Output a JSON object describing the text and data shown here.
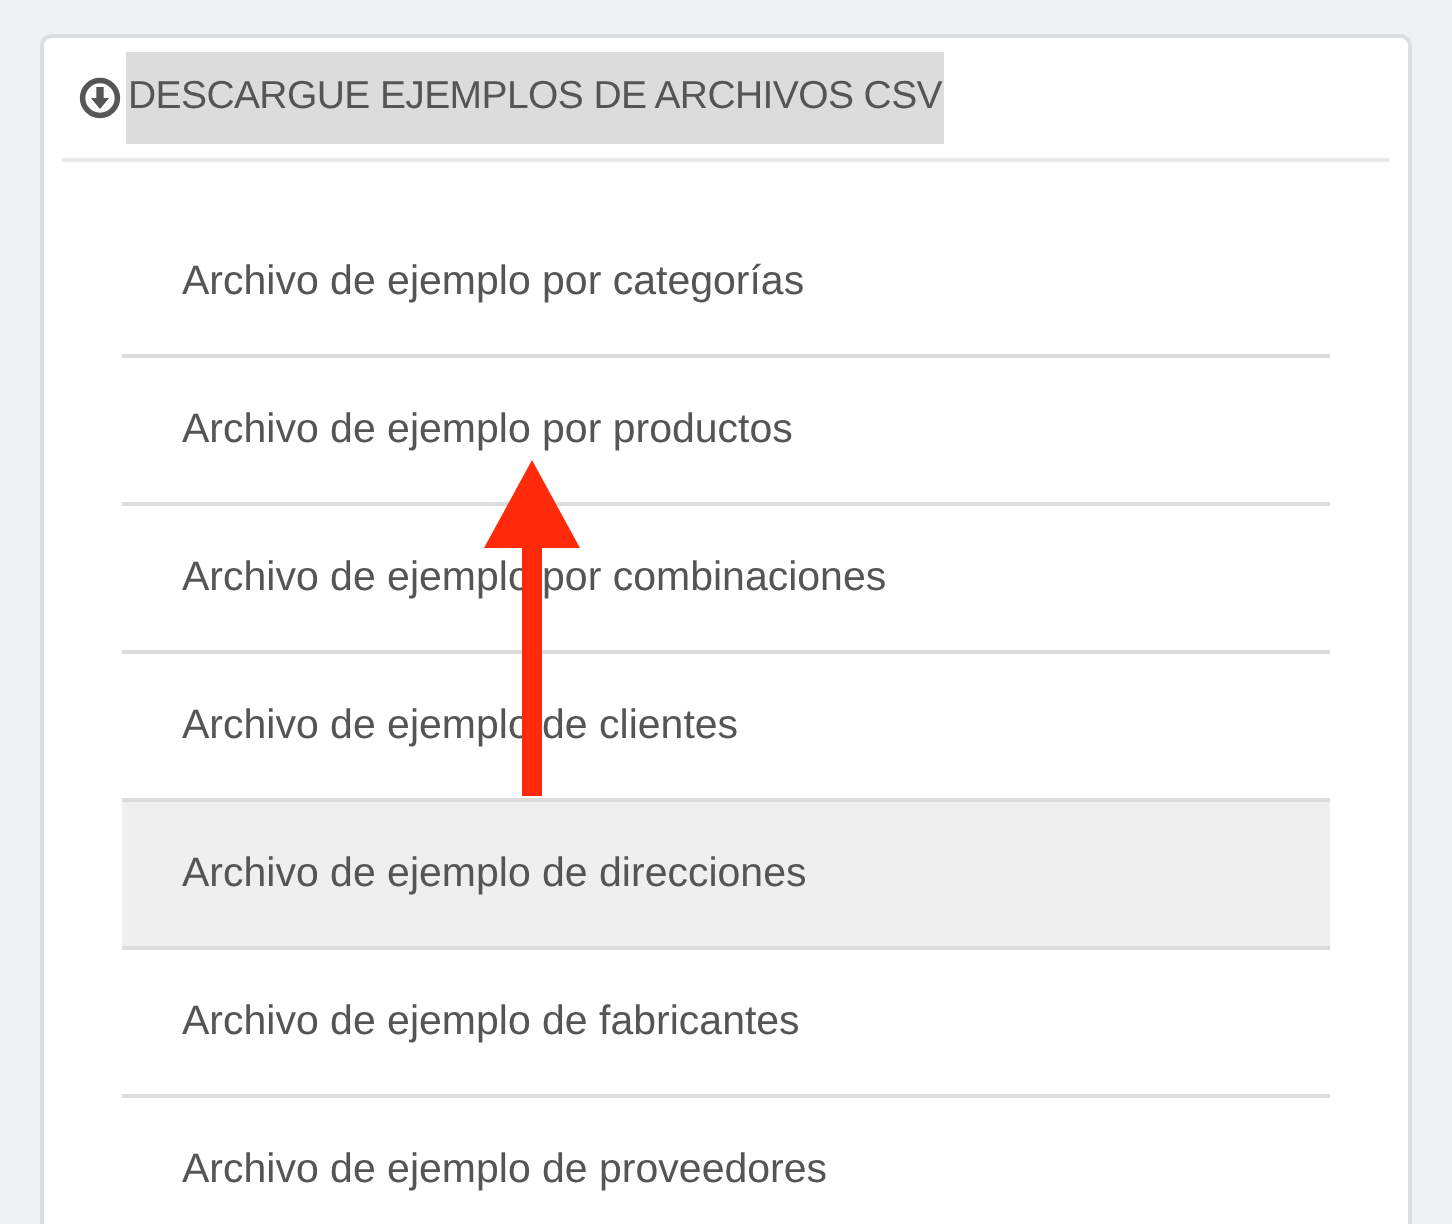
{
  "panel": {
    "title": "DESCARGUE EJEMPLOS DE ARCHIVOS CSV",
    "title_highlighted": true
  },
  "links": [
    {
      "label": "Archivo de ejemplo por categorías",
      "hovered": false
    },
    {
      "label": "Archivo de ejemplo por productos",
      "hovered": false
    },
    {
      "label": "Archivo de ejemplo por combinaciones",
      "hovered": false
    },
    {
      "label": "Archivo de ejemplo de clientes",
      "hovered": false
    },
    {
      "label": "Archivo de ejemplo de direcciones",
      "hovered": true
    },
    {
      "label": "Archivo de ejemplo de fabricantes",
      "hovered": false
    },
    {
      "label": "Archivo de ejemplo de proveedores",
      "hovered": false
    }
  ]
}
